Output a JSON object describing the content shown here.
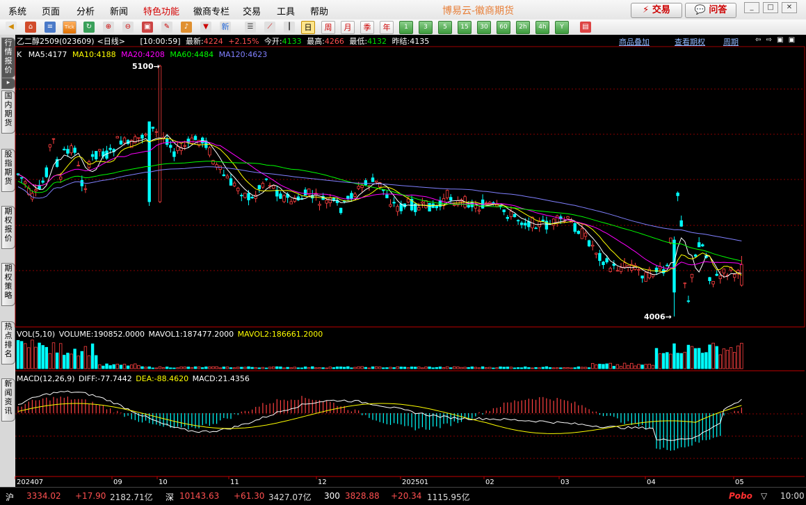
{
  "menu": [
    "系统",
    "页面",
    "分析",
    "新闻",
    "特色功能",
    "徽商专栏",
    "交易",
    "工具",
    "帮助"
  ],
  "brand": "博易云-徽商期货",
  "trade_btn": "交易",
  "qa_btn": "问答",
  "toolbar": {
    "tick_label": "Tick",
    "new_label": "新",
    "periods": [
      "日",
      "周",
      "月",
      "季",
      "年",
      "1",
      "3",
      "5",
      "15",
      "30",
      "60",
      "2h",
      "4h",
      "Y"
    ]
  },
  "side_tabs": [
    "行情报价",
    "国内期货",
    "股指期货",
    "期权报价",
    "期权策略",
    "热点排名",
    "新闻资讯"
  ],
  "header": {
    "symbol": "乙二醇2509",
    "code": "(023609)",
    "period": "<日线>",
    "time": "[10:00:59]",
    "latest_label": "最新:",
    "latest": "4224",
    "change": "+2.15%",
    "open_label": "今开:",
    "open": "4133",
    "high_label": "最高:",
    "high": "4266",
    "low_label": "最低:",
    "low": "4132",
    "prev_label": "昨结:",
    "prev": "4135"
  },
  "links": [
    "商品叠加",
    "查看期权",
    "周期"
  ],
  "ma": {
    "k": "K",
    "ma5": "MA5:4177",
    "ma10": "MA10:4188",
    "ma20": "MA20:4208",
    "ma60": "MA60:4484",
    "ma120": "MA120:4623"
  },
  "vol": {
    "name": "VOL(5,10)",
    "volume": "VOLUME:190852.0000",
    "mavol1": "MAVOL1:187477.2000",
    "mavol2": "MAVOL2:186661.2000"
  },
  "macd": {
    "name": "MACD(12,26,9)",
    "diff": "DIFF:-77.7442",
    "dea": "DEA:-88.4620",
    "macd": "MACD:21.4356"
  },
  "chart_data": {
    "type": "candlestick",
    "annotations": {
      "high_mark": "5100",
      "low_mark": "4006"
    },
    "x_ticks": [
      "202407",
      "09",
      "10",
      "11",
      "12",
      "202501",
      "02",
      "03",
      "04",
      "05"
    ],
    "series_colors": {
      "ma5": "#ffffff",
      "ma10": "#ffff00",
      "ma20": "#ff00ff",
      "ma60": "#00ff00",
      "ma120": "#8080ff",
      "up": "#ff4040",
      "down": "#00ffff"
    }
  },
  "status": {
    "sh_label": "沪",
    "sh_index": "3334.02",
    "sh_change": "+17.90",
    "sh_amount": "2182.71亿",
    "sz_label": "深",
    "sz_index": "10143.63",
    "sz_change": "+61.30",
    "sz_amount": "3427.07亿",
    "hs_label": "300",
    "hs_index": "3828.88",
    "hs_change": "+20.34",
    "hs_amount": "1115.95亿",
    "brand": "Pobo",
    "clock": "10:00"
  }
}
